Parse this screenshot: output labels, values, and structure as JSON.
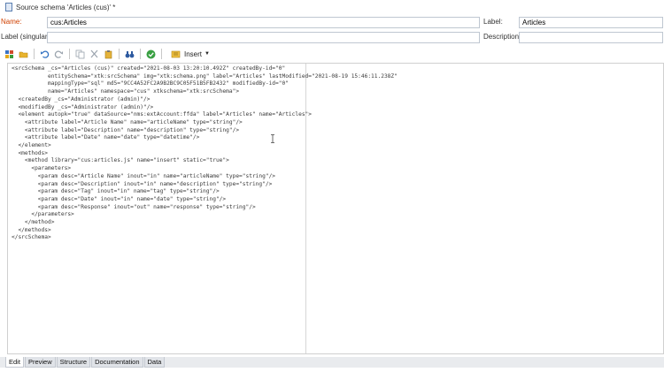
{
  "window": {
    "title": "Source schema 'Articles (cus)' *"
  },
  "form": {
    "name_label": "Name:",
    "name_value": "cus:Articles",
    "label_label": "Label:",
    "label_value": "Articles",
    "singular_label": "Label (singular):",
    "singular_value": "",
    "description_label": "Description:",
    "description_value": ""
  },
  "toolbar": {
    "insert_label": "Insert",
    "icons": [
      "new-document-icon",
      "open-folder-icon",
      "undo-icon",
      "redo-icon",
      "copy-icon",
      "cut-icon",
      "paste-icon",
      "find-binoculars-icon",
      "check-valid-icon",
      "insert-icon",
      "dropdown-arrow-icon"
    ]
  },
  "editor": {
    "code": "<srcSchema _cs=\"Articles (cus)\" created=\"2021-08-03 13:20:10.492Z\" createdBy-id=\"0\"\n           entitySchema=\"xtk:srcSchema\" img=\"xtk:schema.png\" label=\"Articles\" lastModified=\"2021-08-19 15:46:11.238Z\"\n           mappingType=\"sql\" md5=\"9CC4A52FC2A9B2BC9C05F51B5FB2432\" modifiedBy-id=\"0\"\n           name=\"Articles\" namespace=\"cus\" xtkschema=\"xtk:srcSchema\">\n  <createdBy _cs=\"Administrator (admin)\"/>\n  <modifiedBy _cs=\"Administrator (admin)\"/>\n  <element autopk=\"true\" dataSource=\"nms:extAccount:ffda\" label=\"Articles\" name=\"Articles\">\n    <attribute label=\"Article Name\" name=\"articleName\" type=\"string\"/>\n    <attribute label=\"Description\" name=\"description\" type=\"string\"/>\n    <attribute label=\"Date\" name=\"date\" type=\"datetime\"/>\n  </element>\n  <methods>\n    <method library=\"cus:articles.js\" name=\"insert\" static=\"true\">\n      <parameters>\n        <param desc=\"Article Name\" inout=\"in\" name=\"articleName\" type=\"string\"/>\n        <param desc=\"Description\" inout=\"in\" name=\"description\" type=\"string\"/>\n        <param desc=\"Tag\" inout=\"in\" name=\"tag\" type=\"string\"/>\n        <param desc=\"Date\" inout=\"in\" name=\"date\" type=\"string\"/>\n        <param desc=\"Response\" inout=\"out\" name=\"response\" type=\"string\"/>\n      </parameters>\n    </method>\n  </methods>\n</srcSchema>"
  },
  "tabs": [
    {
      "label": "Edit",
      "active": true
    },
    {
      "label": "Preview",
      "active": false
    },
    {
      "label": "Structure",
      "active": false
    },
    {
      "label": "Documentation",
      "active": false
    },
    {
      "label": "Data",
      "active": false
    }
  ]
}
